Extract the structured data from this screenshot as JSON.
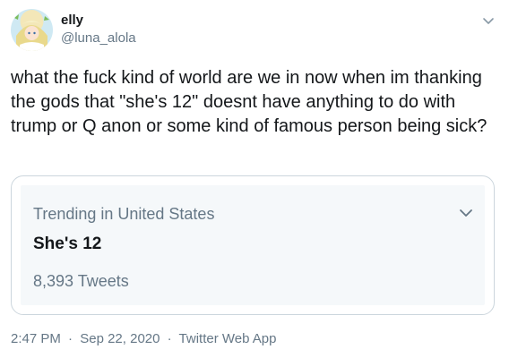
{
  "author": {
    "display_name": "elly",
    "handle": "@luna_alola",
    "avatar_icon": "avatar-illustration"
  },
  "tweet": {
    "text": "what the fuck kind of world are we in now when im thanking the gods that \"she's 12\" doesnt have anything to do with trump or Q anon or some kind of famous person being sick?"
  },
  "trend_card": {
    "context": "Trending in United States",
    "title": "She's 12",
    "tweet_count": "8,393 Tweets"
  },
  "meta": {
    "time": "2:47 PM",
    "separator": "·",
    "date": "Sep 22, 2020",
    "source": "Twitter Web App"
  },
  "colors": {
    "text_primary": "#14171a",
    "text_secondary": "#657786",
    "card_border": "#ccd6dd",
    "card_background": "#f5f8fa"
  }
}
